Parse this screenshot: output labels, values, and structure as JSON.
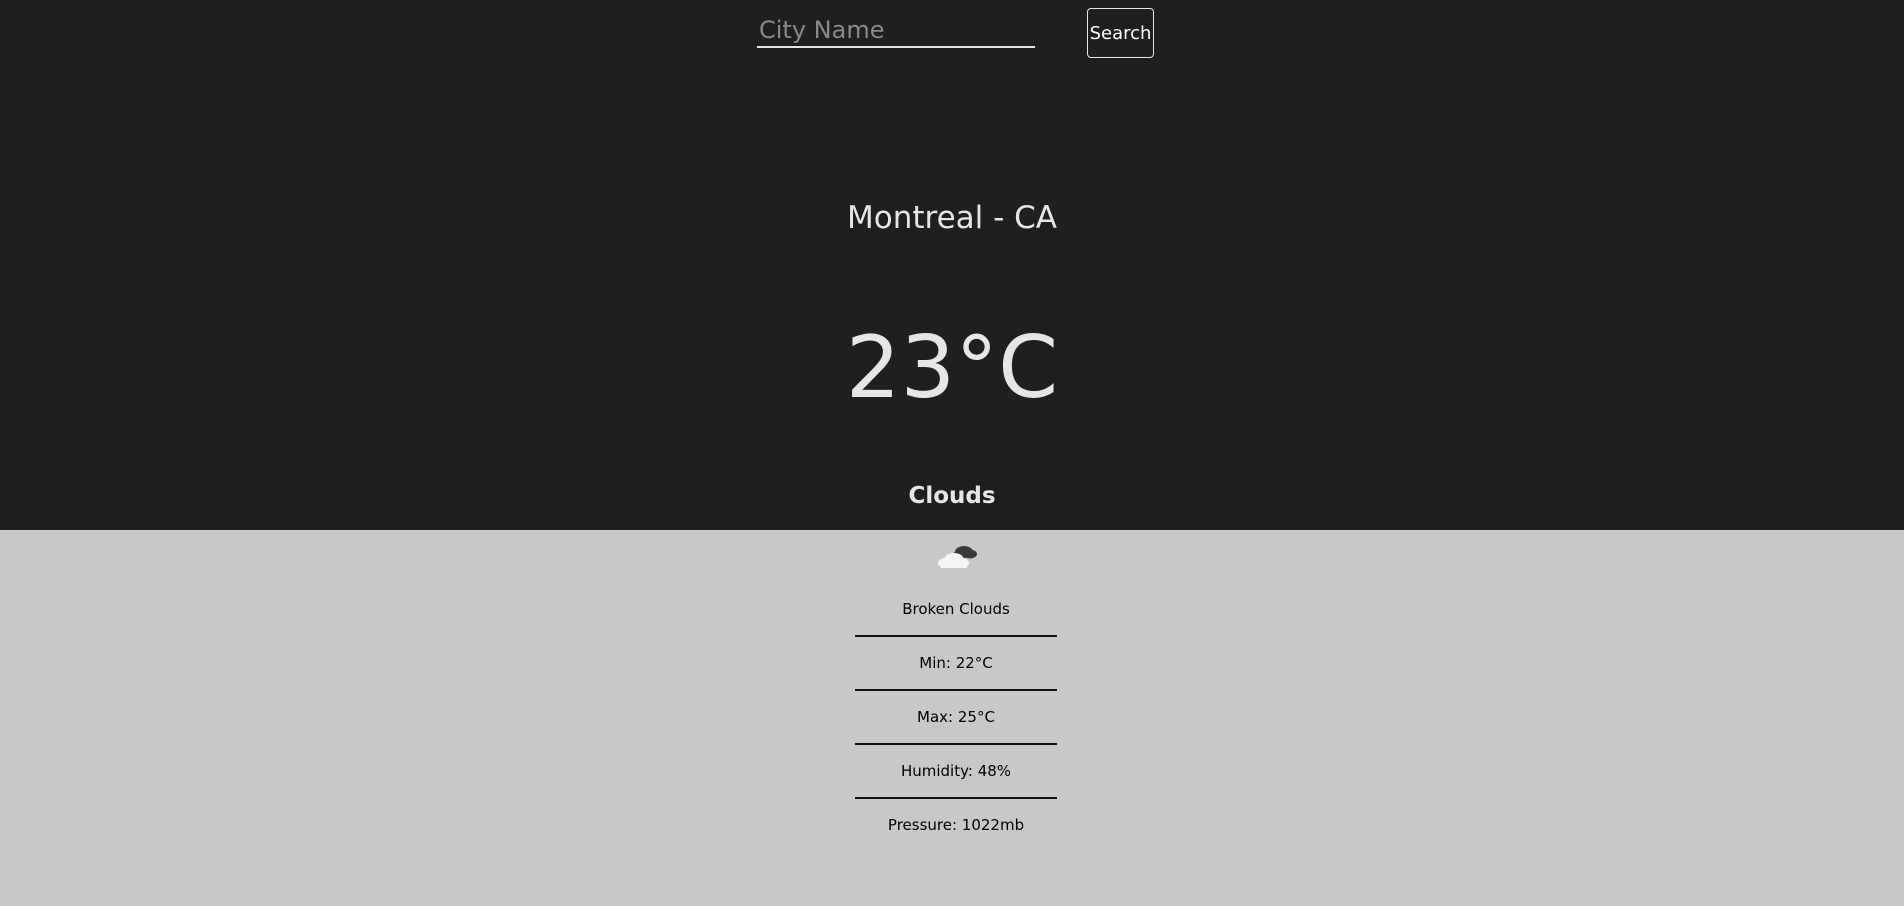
{
  "search": {
    "placeholder": "City Name",
    "value": "",
    "button_label": "Search"
  },
  "weather": {
    "location": "Montreal - CA",
    "temperature": "23°C",
    "condition": "Clouds",
    "icon": "broken-clouds-icon",
    "details": [
      "Broken Clouds",
      "Min: 22°C",
      "Max: 25°C",
      "Humidity: 48%",
      "Pressure: 1022mb"
    ]
  },
  "colors": {
    "top_background": "#1f1f1f",
    "bottom_background": "#c8c8c8",
    "top_text": "#e6e6e6",
    "bottom_text": "#111111"
  }
}
